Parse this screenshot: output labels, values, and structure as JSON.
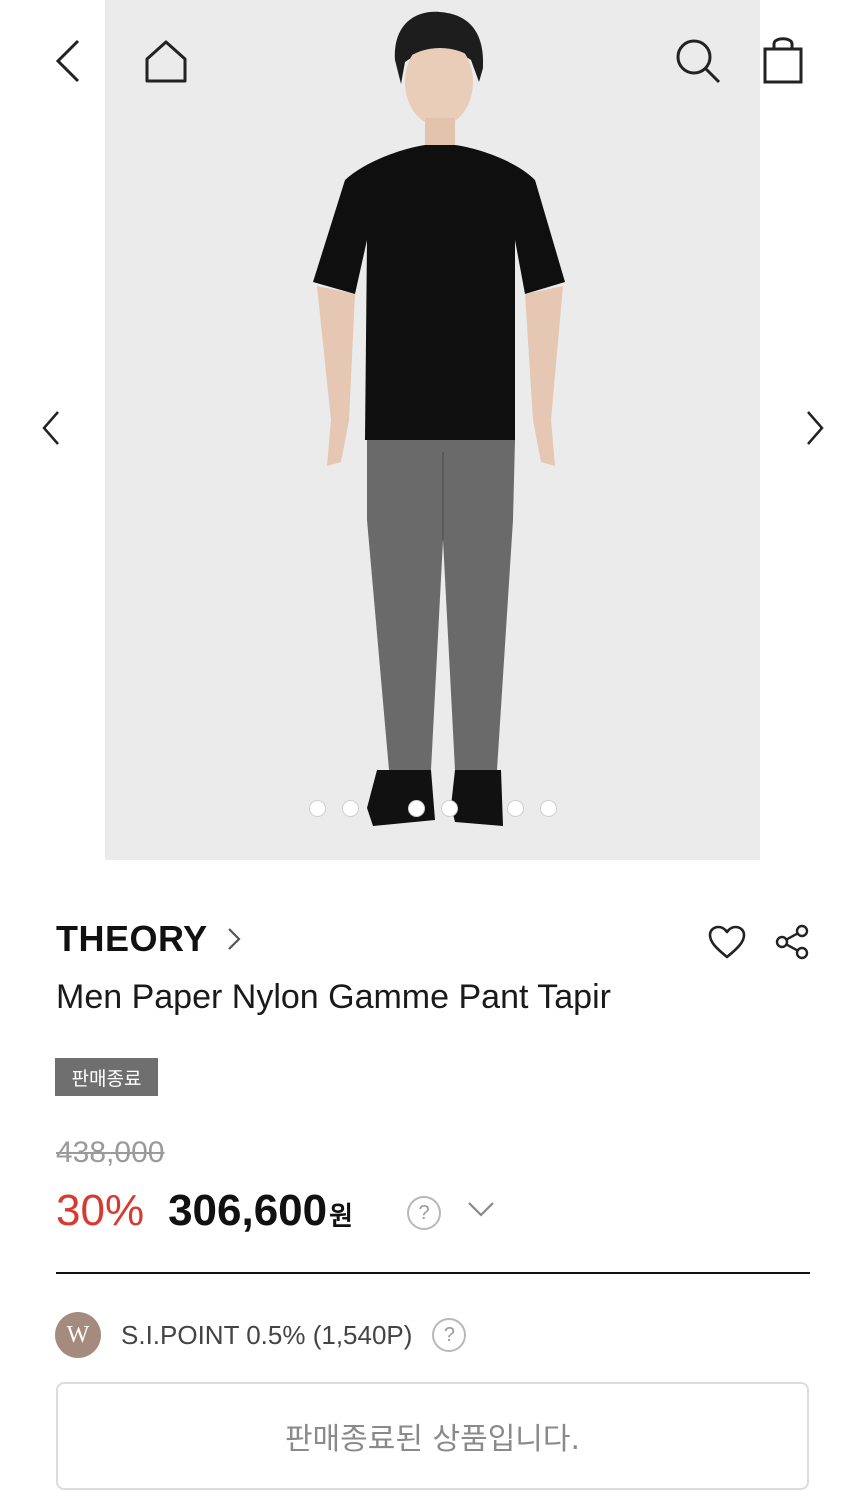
{
  "header": {
    "icons": [
      "back-icon",
      "home-icon",
      "search-icon",
      "shopping-bag-icon"
    ]
  },
  "gallery": {
    "prev_icon": "chevron-left-icon",
    "next_icon": "chevron-right-icon",
    "slide_count": 8,
    "active_slides": [
      3,
      6
    ]
  },
  "product": {
    "brand": "THEORY",
    "name": "Men Paper Nylon Gamme Pant Tapir",
    "status_badge": "판매종료",
    "original_price": "438,000",
    "discount": "30%",
    "price": "306,600",
    "currency": "원",
    "help_mark": "?",
    "actions": [
      "heart-icon",
      "share-icon"
    ]
  },
  "points": {
    "logo_letter": "W",
    "text": "S.I.POINT 0.5% (1,540P)",
    "help_mark": "?"
  },
  "soldout_message": "판매종료된 상품입니다.",
  "colors": {
    "discount": "#d73a31",
    "badge_bg": "#6f6f6f",
    "point_logo": "#a58b7e",
    "photo_bg": "#ebebeb"
  }
}
